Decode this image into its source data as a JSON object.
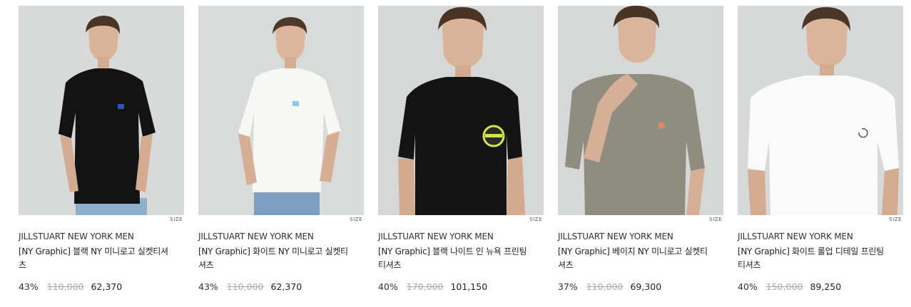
{
  "products": [
    {
      "brand": "JILLSTUART NEW YORK MEN",
      "name": "[NY Graphic] 블랙 NY 미니로고 실켓티셔츠",
      "discount": "43%",
      "original_price": "110,000",
      "sale_price": "62,370",
      "size_label": "SIZE",
      "shirt_color": "#121212",
      "logo_color": "#2a57b8",
      "image_icon": "model-black-tshirt-icon"
    },
    {
      "brand": "JILLSTUART NEW YORK MEN",
      "name": "[NY Graphic] 화이트 NY 미니로고 실켓티셔츠",
      "discount": "43%",
      "original_price": "110,000",
      "sale_price": "62,370",
      "size_label": "SIZE",
      "shirt_color": "#f7f7f5",
      "logo_color": "#8fc7e6",
      "image_icon": "model-white-tshirt-icon"
    },
    {
      "brand": "JILLSTUART NEW YORK MEN",
      "name": "[NY Graphic] 블랙 나이트 인 뉴욕 프린팅 티셔츠",
      "discount": "40%",
      "original_price": "170,000",
      "sale_price": "101,150",
      "size_label": "SIZE",
      "shirt_color": "#151515",
      "logo_color": "#d4e34a",
      "image_icon": "model-black-print-tshirt-icon"
    },
    {
      "brand": "JILLSTUART NEW YORK MEN",
      "name": "[NY Graphic] 베이지 NY 미니로고 실켓티셔츠",
      "discount": "37%",
      "original_price": "110,000",
      "sale_price": "69,300",
      "size_label": "SIZE",
      "shirt_color": "#8f8d80",
      "logo_color": "#d88a6a",
      "image_icon": "model-beige-tshirt-icon"
    },
    {
      "brand": "JILLSTUART NEW YORK MEN",
      "name": "[NY Graphic] 화이트 롤업 디테일 프린팅 티셔츠",
      "discount": "40%",
      "original_price": "150,000",
      "sale_price": "89,250",
      "size_label": "SIZE",
      "shirt_color": "#fafafa",
      "logo_color": "#555555",
      "image_icon": "model-white-rollup-tshirt-icon"
    }
  ]
}
